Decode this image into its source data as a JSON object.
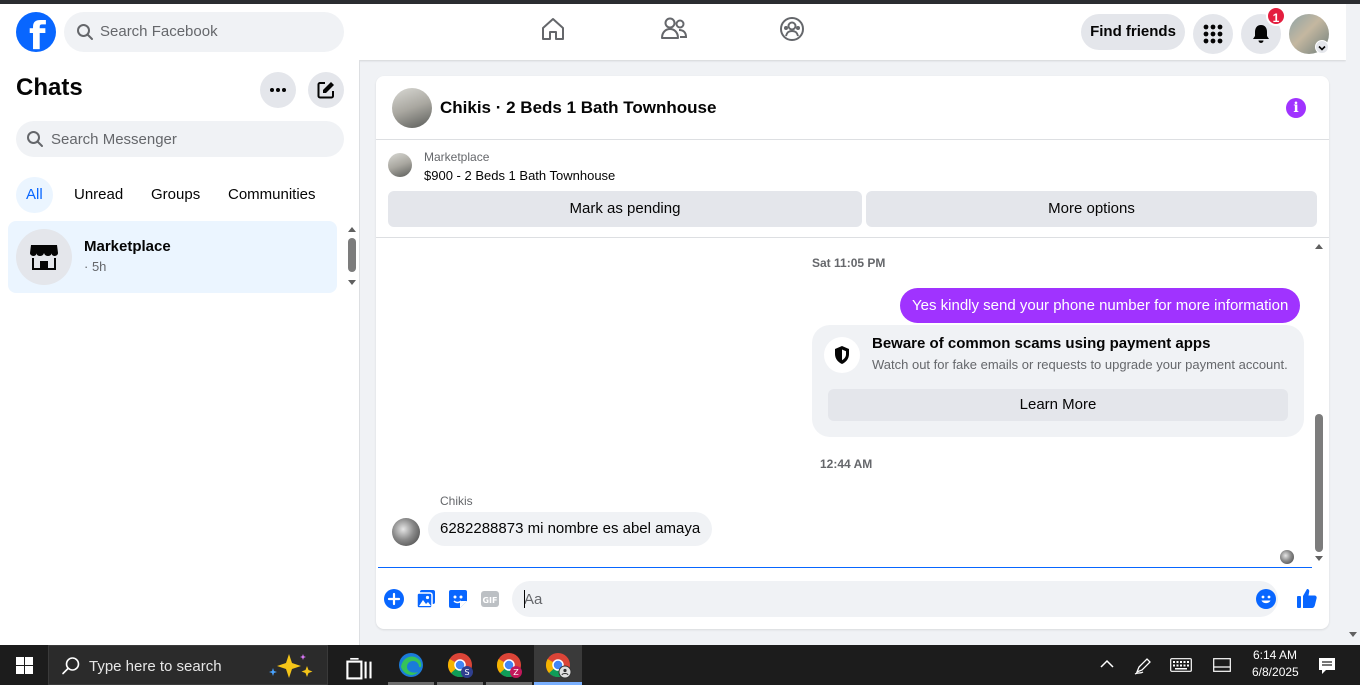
{
  "topbar": {
    "search_placeholder": "Search Facebook",
    "find_friends_label": "Find friends",
    "notification_count": "1"
  },
  "chats": {
    "title": "Chats",
    "search_placeholder": "Search Messenger",
    "filters": [
      "All",
      "Unread",
      "Groups",
      "Communities"
    ],
    "items": [
      {
        "name": "Marketplace",
        "time": "· 5h"
      }
    ]
  },
  "conversation": {
    "title": "Chikis · 2 Beds 1 Bath Townhouse",
    "marketplace_label": "Marketplace",
    "listing": "$900 - 2 Beds 1 Bath Townhouse",
    "mark_pending_label": "Mark as pending",
    "more_options_label": "More options",
    "messages": {
      "timestamp_1": "Sat 11:05 PM",
      "outgoing_1": "Yes kindly send your phone number for more information",
      "scam_title": "Beware of common scams using payment apps",
      "scam_desc": "Watch out for fake emails or requests to upgrade your payment account.",
      "learn_more_label": "Learn More",
      "timestamp_2": "12:44 AM",
      "sender_name": "Chikis",
      "incoming_1": "6282288873 mi nombre es abel amaya"
    },
    "composer_placeholder": "Aa"
  },
  "taskbar": {
    "search_placeholder": "Type here to search",
    "time": "6:14 AM",
    "date": "6/8/2025",
    "chrome_badges": [
      "S",
      "Z"
    ]
  },
  "colors": {
    "facebook_blue": "#0866ff",
    "messenger_purple": "#a033ff",
    "notification_red": "#e41e3f"
  }
}
